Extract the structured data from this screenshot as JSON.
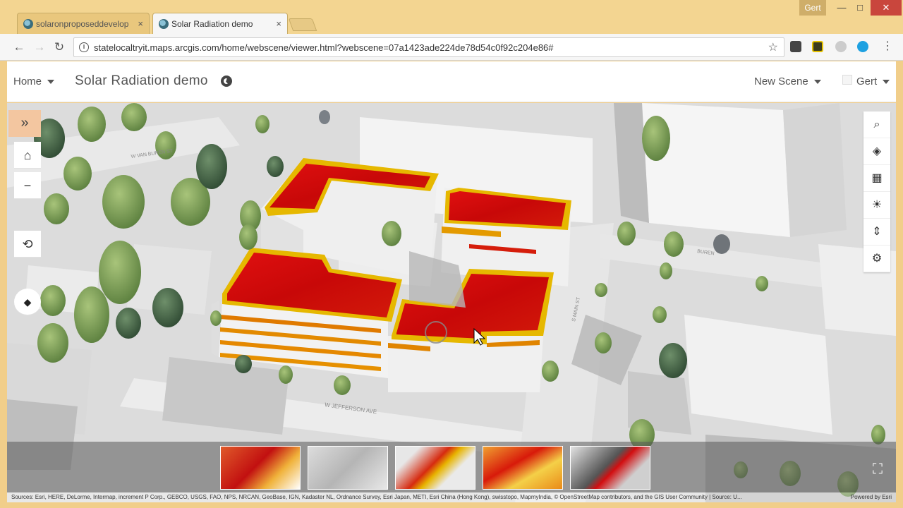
{
  "browser": {
    "tabs": [
      {
        "title": "solaronproposeddevelop",
        "active": false
      },
      {
        "title": "Solar Radiation demo",
        "active": true
      }
    ],
    "close_glyph": "×",
    "profile_name": "Gert",
    "url": "statelocaltryit.maps.arcgis.com/home/webscene/viewer.html?webscene=07a1423ade224de78d54c0f92c204e86#",
    "controls": {
      "back": "←",
      "forward": "→",
      "reload": "↻",
      "star": "☆",
      "menu": "⋮",
      "info": "i"
    },
    "window": {
      "minimize": "—",
      "maximize": "□",
      "close": "✕"
    }
  },
  "app": {
    "home_label": "Home",
    "scene_title": "Solar Radiation demo",
    "new_scene_label": "New Scene",
    "user_label": "Gert"
  },
  "map_controls": {
    "expand": "»",
    "home": "⌂",
    "zoom_in": "+",
    "zoom_out": "−",
    "pan": "✥",
    "rotate": "⟲",
    "compass": "◆"
  },
  "right_tools": [
    "search-icon",
    "layers-icon",
    "basemap-icon",
    "daylight-icon",
    "measure-icon",
    "settings-icon"
  ],
  "right_tool_glyphs": {
    "search": "⌕",
    "layers": "◈",
    "basemap": "▦",
    "daylight": "☀",
    "measure": "⇕",
    "settings": "⚙"
  },
  "street_labels": [
    "W VAN BUREN ST",
    "W JEFFERSON AVE",
    "S MAIN ST",
    "BUREN"
  ],
  "slides_count": 5,
  "fullscreen_glyph": "⛶",
  "attribution": "Sources: Esri, HERE, DeLorme, Intermap, increment P Corp., GEBCO, USGS, FAO, NPS, NRCAN, GeoBase, IGN, Kadaster NL, Ordnance Survey, Esri Japan, METI, Esri China (Hong Kong), swisstopo, MapmyIndia, © OpenStreetMap contributors, and the GIS User Community | Source: U...",
  "powered_by": "Powered by Esri",
  "colors": {
    "radiation_high": "#d40b0b",
    "radiation_edge": "#e8b600",
    "accent_expand": "#f3c6a0",
    "chrome": "#f3d591"
  }
}
